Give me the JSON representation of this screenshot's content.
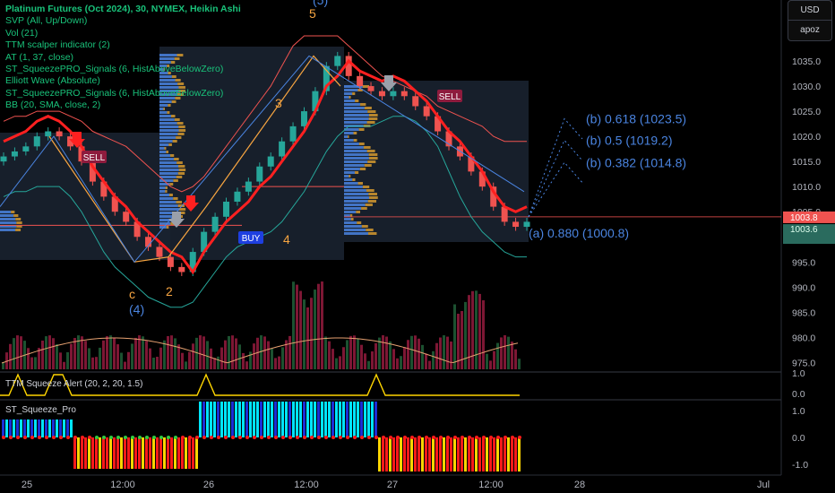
{
  "legend": {
    "title": "Platinum Futures (Oct 2024), 30, NYMEX, Heikin Ashi",
    "indicators": [
      "SVP (All, Up/Down)",
      "Vol (21)",
      "TTM scalper indicator (2)",
      "AT (1, 37, close)",
      "ST_SqueezePRO_Signals (6, HistAboveBelowZero)",
      "Elliott Wave (Absolute)",
      "ST_SqueezePRO_Signals (6, HistAboveBelowZero)",
      "BB (20, SMA, close, 2)"
    ]
  },
  "currency": {
    "label": "USD",
    "unit": "apoz"
  },
  "subpanes": {
    "alert_title": "TTM Squeeze Alert (20, 2, 20, 1.5)",
    "pro_title": "ST_Squeeze_Pro"
  },
  "colors": {
    "bull": "#26a69a",
    "bear": "#ef5350",
    "bb": "#ef5350",
    "svp": "#4a84e0",
    "svp_down": "#e0a030",
    "wave": "#f7a541",
    "wave_blue": "#4a84e0",
    "cyan": "#00e5ff",
    "blue": "#1a2ed6",
    "red": "#ff1a1a",
    "yellow": "#ffd600",
    "green": "#2ecc40"
  },
  "chart_data": {
    "type": "candlestick",
    "title": "Platinum Futures (Oct 2024), 30, NYMEX, Heikin Ashi",
    "price_axis": {
      "ylim": [
        974,
        1040
      ],
      "ticks": [
        975.0,
        980.0,
        985.0,
        990.0,
        995.0,
        1000.0,
        1005.0,
        1010.0,
        1015.0,
        1020.0,
        1025.0,
        1030.0,
        1035.0
      ]
    },
    "last_price_labels": [
      1003.8,
      1003.6
    ],
    "time_axis": [
      "25",
      "12:00",
      "26",
      "12:00",
      "27",
      "12:00",
      "28",
      "Jul"
    ],
    "close": [
      1016,
      1017,
      1018,
      1020,
      1021,
      1020,
      1018,
      1015,
      1011,
      1008,
      1005,
      1003,
      1000,
      998,
      996,
      994,
      993,
      997,
      1001,
      1004,
      1007,
      1009,
      1011,
      1014,
      1016,
      1019,
      1022,
      1025,
      1029,
      1034,
      1036,
      1032,
      1030,
      1029,
      1028,
      1029,
      1028,
      1026,
      1024,
      1021,
      1018,
      1016,
      1013,
      1010,
      1006,
      1003,
      1002,
      1003
    ],
    "bollinger": {
      "upper": [
        1023,
        1024,
        1024,
        1025,
        1025,
        1025,
        1024,
        1023,
        1021,
        1020,
        1019,
        1018,
        1016,
        1014,
        1012,
        1010,
        1009,
        1010,
        1012,
        1015,
        1018,
        1021,
        1024,
        1027,
        1030,
        1034,
        1038,
        1040,
        1040,
        1040,
        1040,
        1038,
        1036,
        1034,
        1032,
        1031,
        1030,
        1029,
        1028,
        1026,
        1025,
        1024,
        1023,
        1022,
        1020,
        1019,
        1019,
        1019
      ],
      "lower": [
        1008,
        1009,
        1009,
        1010,
        1010,
        1010,
        1008,
        1005,
        1001,
        997,
        994,
        992,
        990,
        988,
        987,
        986,
        986,
        987,
        990,
        993,
        996,
        998,
        999,
        1000,
        1001,
        1003,
        1006,
        1009,
        1013,
        1017,
        1020,
        1022,
        1022,
        1022,
        1023,
        1024,
        1024,
        1023,
        1021,
        1018,
        1013,
        1008,
        1004,
        1001,
        999,
        997,
        996,
        996
      ]
    },
    "volume_axis": [
      "975.0",
      "980.0",
      "985.0",
      "990.0"
    ],
    "annotations": [
      {
        "text": "(b) 0.618 (1023.5)",
        "price": 1023.5
      },
      {
        "text": "(b) 0.5 (1019.2)",
        "price": 1019.2
      },
      {
        "text": "(b) 0.382 (1014.8)",
        "price": 1014.8
      },
      {
        "text": "(a) 0.880 (1000.8)",
        "price": 1000.8
      }
    ],
    "wave_labels": [
      {
        "text": "5",
        "color": "orange"
      },
      {
        "text": "(5)",
        "color": "blue"
      },
      {
        "text": "3",
        "color": "orange"
      },
      {
        "text": "4",
        "color": "orange"
      },
      {
        "text": "2",
        "color": "orange"
      },
      {
        "text": "c",
        "color": "orange"
      },
      {
        "text": "(4)",
        "color": "blue"
      }
    ],
    "signals": [
      "SELL",
      "BUY",
      "SELL"
    ],
    "alert_axis": [
      "1.0",
      "0.0"
    ],
    "pro_axis": [
      "1.0",
      "0.0",
      "-1.0"
    ]
  }
}
